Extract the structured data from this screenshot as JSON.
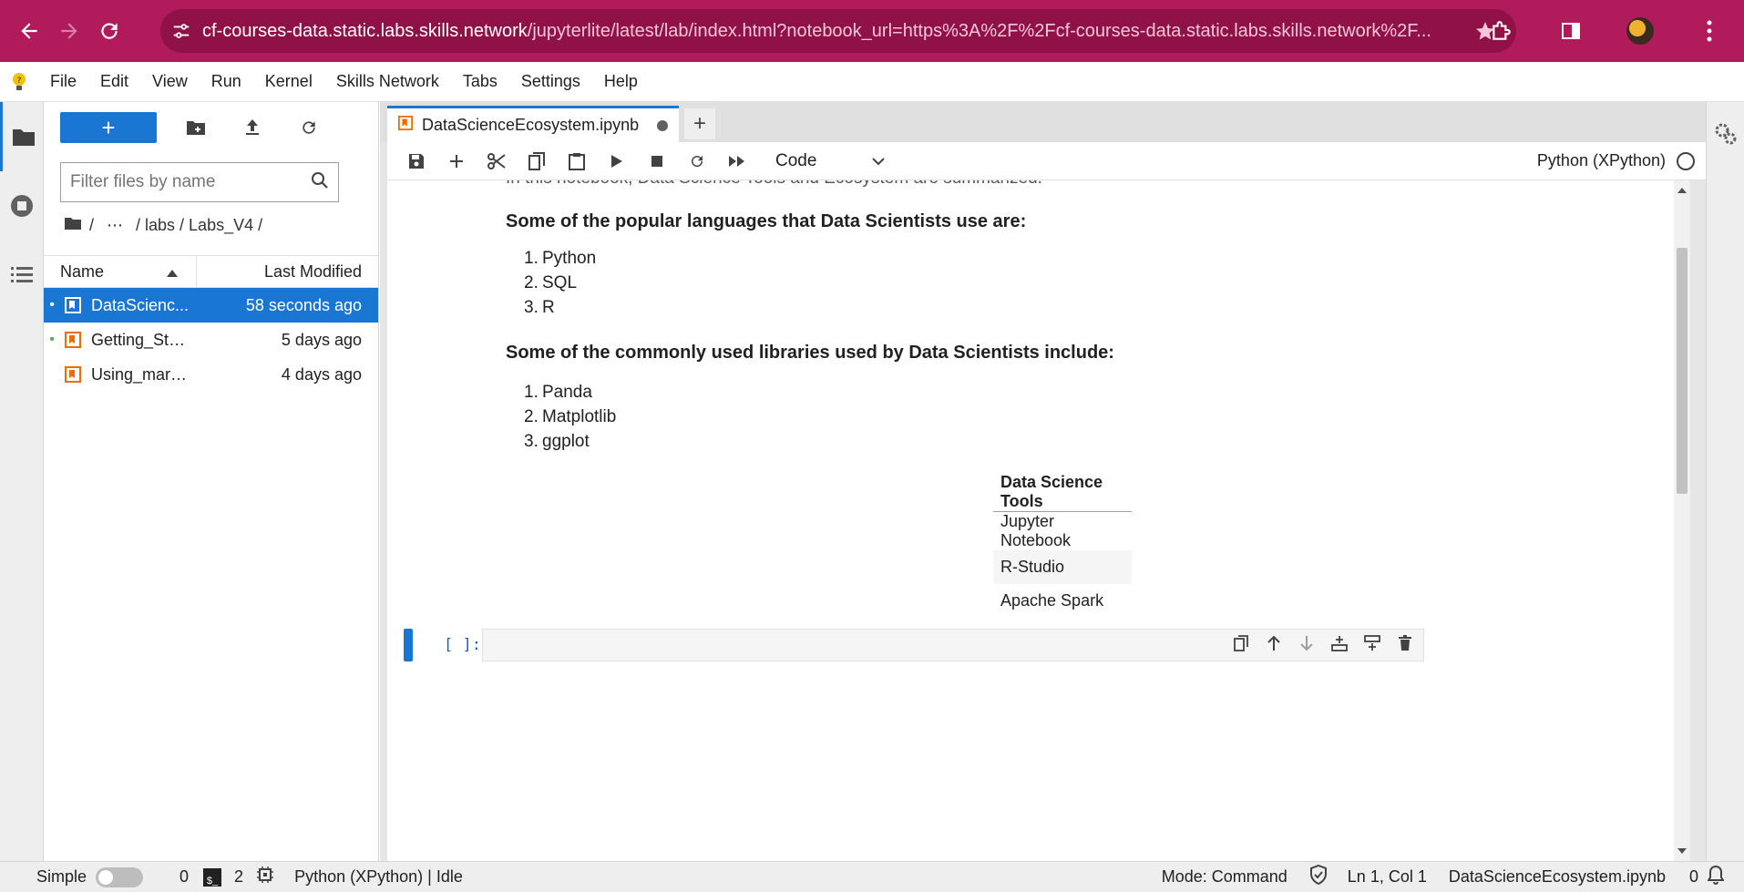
{
  "browser": {
    "url_host": "cf-courses-data.static.labs.skills.network",
    "url_path": "/jupyterlite/latest/lab/index.html?notebook_url=https%3A%2F%2Fcf-courses-data.static.labs.skills.network%2F..."
  },
  "menubar": {
    "items": [
      "File",
      "Edit",
      "View",
      "Run",
      "Kernel",
      "Skills Network",
      "Tabs",
      "Settings",
      "Help"
    ]
  },
  "filebrowser": {
    "new_label": "+",
    "filter_placeholder": "Filter files by name",
    "breadcrumbs": [
      "/",
      "⋯",
      "/ labs / Labs_V4 /"
    ],
    "col_name": "Name",
    "col_modified": "Last Modified",
    "files": [
      {
        "name": "DataScienc...",
        "modified": "58 seconds ago",
        "selected": true,
        "running": true
      },
      {
        "name": "Getting_Sta...",
        "modified": "5 days ago",
        "selected": false,
        "running": true
      },
      {
        "name": "Using_mark...",
        "modified": "4 days ago",
        "selected": false,
        "running": false
      }
    ]
  },
  "tabs": [
    {
      "label": "DataScienceEcosystem.ipynb",
      "dirty": true
    }
  ],
  "toolbar": {
    "cell_type": "Code",
    "kernel": "Python (XPython)"
  },
  "notebook": {
    "cut_line": "In this notebook, Data Science Tools and Ecosystem are summarized.",
    "languages_heading": "Some of the popular languages that Data Scientists use are:",
    "languages": [
      "Python",
      "SQL",
      "R"
    ],
    "libraries_heading": "Some of the commonly used libraries used by Data Scientists include:",
    "libraries": [
      "Panda",
      "Matplotlib",
      "ggplot"
    ],
    "tools_table": {
      "header": "Data Science Tools",
      "rows": [
        "Jupyter Notebook",
        "R-Studio",
        "Apache Spark"
      ]
    },
    "code_prompt": "[ ]:"
  },
  "status": {
    "simple_label": "Simple",
    "kernels_count": "0",
    "terminals_count": "2",
    "kernel_status": "Python (XPython) | Idle",
    "mode": "Mode: Command",
    "cursor": "Ln 1, Col 1",
    "filename": "DataScienceEcosystem.ipynb",
    "notifications": "0"
  },
  "colors": {
    "browser_accent": "#b11a5b",
    "jupyter_blue": "#1976d2"
  }
}
